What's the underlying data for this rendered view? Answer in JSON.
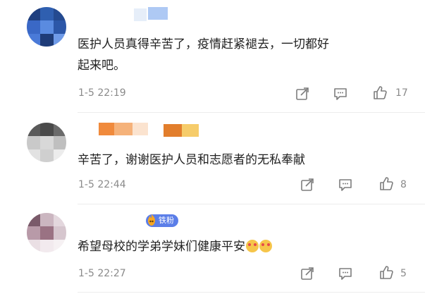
{
  "comments": [
    {
      "text_line1": "医护人员真得辛苦了，疫情赶紧褪去，一切都好",
      "text_line2": "起来吧。",
      "time": "1-5 22:19",
      "likes": "17"
    },
    {
      "text_line1": "辛苦了，谢谢医护人员和志愿者的无私奉献",
      "time": "1-5 22:44",
      "likes": "8"
    },
    {
      "badge": "铁粉",
      "text_line1": "希望母校的学弟学妹们健康平安",
      "time": "1-5 22:27",
      "likes": "5"
    }
  ],
  "icons": {
    "share": "share-icon",
    "reply": "comment-icon",
    "like": "thumbs-up-icon"
  },
  "colors": {
    "text": "#222222",
    "meta": "#8a8a8a",
    "badge": "#5b7ee8"
  }
}
